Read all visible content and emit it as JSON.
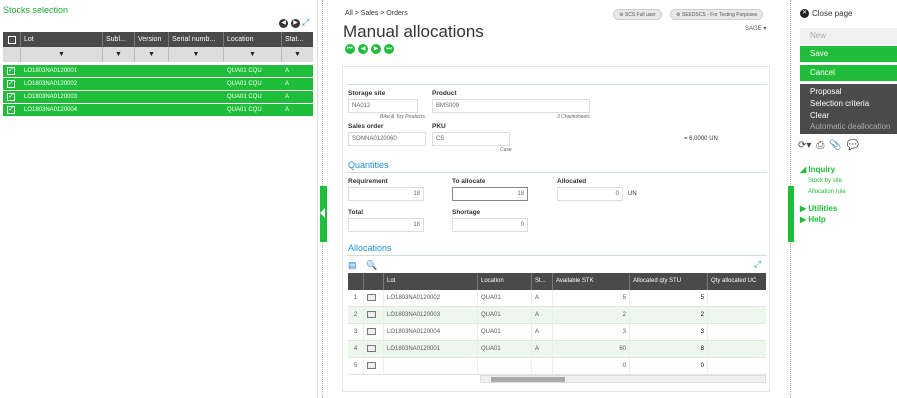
{
  "left_panel": {
    "title": "Stocks selection",
    "columns": [
      "Lot",
      "Subl...",
      "Version",
      "Serial numb...",
      "Location",
      "Stat..."
    ],
    "rows": [
      {
        "lot": "LO1803NA0120001",
        "location": "QUA01 CQU",
        "status": "A"
      },
      {
        "lot": "LO1803NA0120002",
        "location": "QUA01 CQU",
        "status": "A"
      },
      {
        "lot": "LO1803NA0120003",
        "location": "QUA01 CQU",
        "status": "A"
      },
      {
        "lot": "LO1803NA0120004",
        "location": "QUA01 CQU",
        "status": "A"
      }
    ]
  },
  "header": {
    "breadcrumb": [
      "All",
      "Sales",
      "Orders"
    ],
    "user_badge": "SCS Full user",
    "env_badge": "SEEDSCS - For Testing Purposes",
    "title": "Manual allocations",
    "company": "SAGE"
  },
  "form": {
    "storage_site_label": "Storage site",
    "storage_site_value": "NA012",
    "storage_site_desc": "Bike & Toy Products",
    "product_label": "Product",
    "product_value": "BMS009",
    "product_desc": "3 Chainwheels",
    "sales_order_label": "Sales order",
    "sales_order_value": "SONNA0120060",
    "pku_label": "PKU",
    "pku_value": "CS",
    "pku_desc": "Case",
    "conversion": "= 6.0000 UN",
    "quantities_title": "Quantities",
    "requirement_label": "Requirement",
    "requirement_value": "18",
    "to_allocate_label": "To allocate",
    "to_allocate_value": "18",
    "allocated_label": "Allocated",
    "allocated_value": "0",
    "allocated_unit": "UN",
    "total_label": "Total",
    "total_value": "18",
    "shortage_label": "Shortage",
    "shortage_value": "0"
  },
  "allocations": {
    "title": "Allocations",
    "columns": [
      "Lot",
      "Location",
      "St...",
      "Available STK",
      "Allocated qty STU",
      "Qty allocated UC"
    ],
    "rows": [
      {
        "n": "1",
        "lot": "LO1803NA0120002",
        "location": "QUA01",
        "status": "A",
        "available": "5",
        "allocated": "5"
      },
      {
        "n": "2",
        "lot": "LO1803NA0120003",
        "location": "QUA01",
        "status": "A",
        "available": "2",
        "allocated": "2"
      },
      {
        "n": "3",
        "lot": "LO1803NA0120004",
        "location": "QUA01",
        "status": "A",
        "available": "3",
        "allocated": "3"
      },
      {
        "n": "4",
        "lot": "LO1803NA0120001",
        "location": "QUA01",
        "status": "A",
        "available": "60",
        "allocated": "8"
      },
      {
        "n": "5",
        "lot": "",
        "location": "",
        "status": "",
        "available": "0",
        "allocated": "0"
      }
    ]
  },
  "right_panel": {
    "close_page": "Close page",
    "new": "New",
    "save": "Save",
    "cancel": "Cancel",
    "proposal": "Proposal",
    "selection_criteria": "Selection criteria",
    "clear": "Clear",
    "auto_dealloc": "Automatic deallocation",
    "inquiry": "Inquiry",
    "stock_by_site": "Stock by site",
    "allocation_rule": "Allocation rule",
    "utilities": "Utilities",
    "help": "Help"
  },
  "colors": {
    "accent": "#1fbd3a",
    "link": "#1e90d8",
    "dark": "#4a4a4a"
  }
}
